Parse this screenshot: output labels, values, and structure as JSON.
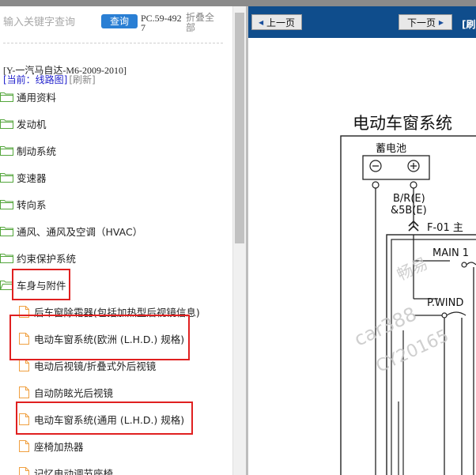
{
  "search": {
    "placeholder": "输入关键字查询",
    "button_label": "查询"
  },
  "pc_code": "PC.59-4927",
  "collapse_all_label": "折叠全部",
  "model": "[Y-一汽马自达-M6-2009-2010]",
  "current_label": "[当前：线路图]",
  "refresh_label": "[刷新]",
  "folders": [
    "通用资料",
    "发动机",
    "制动系统",
    "变速器",
    "转向系",
    "通风、通风及空调（HVAC）",
    "约束保护系统",
    "车身与附件"
  ],
  "files": [
    "后车窗除霜器(包括加热型后视镜信息)",
    "电动车窗系统(欧洲 (L.H.D.) 规格)",
    "电动后视镜/折叠式外后视镜",
    "自动防眩光后视镜",
    "电动车窗系统(通用 (L.H.D.) 规格)",
    "座椅加热器",
    "记忆电动调节座椅"
  ],
  "viewer": {
    "prev_label": "上一页",
    "next_label": "下一页",
    "clip_label": "[刷",
    "diagram": {
      "title": "电动车窗系统",
      "battery_label": "蓄电池",
      "wire_label_1": "B/R(E)",
      "wire_label_2": "&5B(E)",
      "fuse_label": "F-01 主",
      "main_label": "MAIN 1",
      "pwind_label": "P.WIND",
      "watermark_1": "畅易",
      "watermark_2": "car388",
      "watermark_3": "CY20165"
    }
  },
  "colors": {
    "accent_blue": "#2a7fd4",
    "viewer_bar": "#0f4d8c",
    "highlight_red": "#e02020",
    "current_blue": "#2222cc"
  }
}
